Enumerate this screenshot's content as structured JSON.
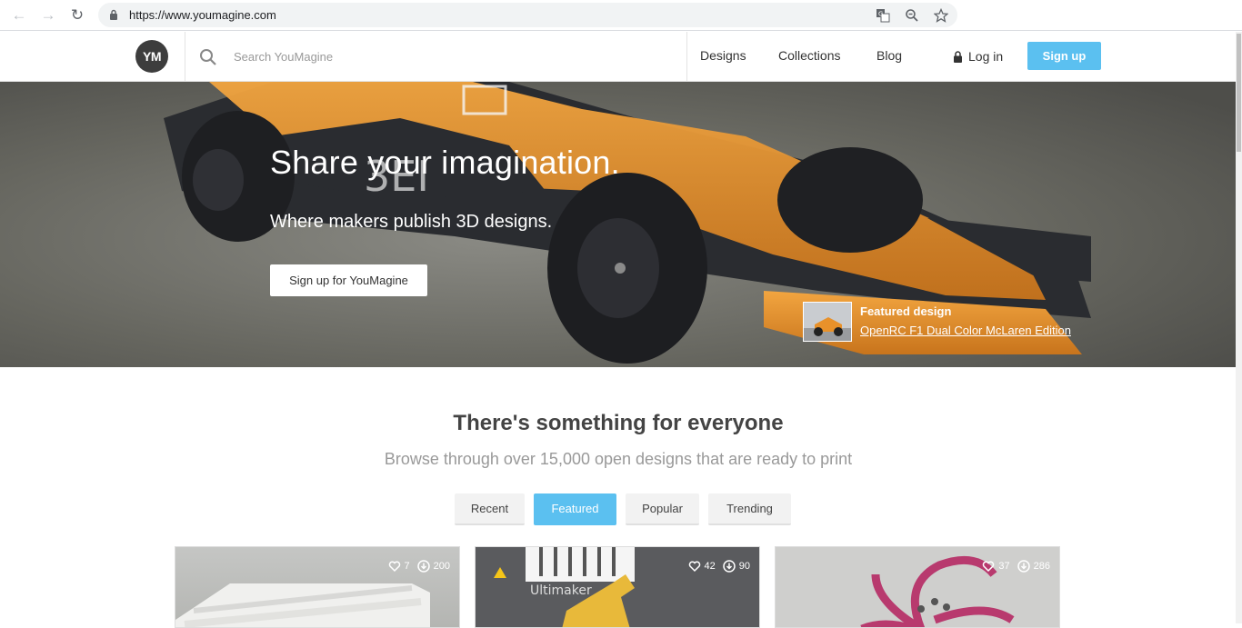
{
  "browser": {
    "url": "https://www.youmagine.com"
  },
  "header": {
    "logo_text": "YM",
    "search_placeholder": "Search YouMagine",
    "nav": [
      "Designs",
      "Collections",
      "Blog"
    ],
    "login_label": "Log in",
    "signup_label": "Sign up"
  },
  "hero": {
    "title": "Share your imagination.",
    "subtitle": "Where makers publish 3D designs.",
    "cta_label": "Sign up for YouMagine",
    "featured_label": "Featured design",
    "featured_link": "OpenRC F1 Dual Color McLaren Edition"
  },
  "main": {
    "title": "There's something for everyone",
    "subtitle": "Browse through over 15,000 open designs that are ready to print",
    "tabs": [
      "Recent",
      "Featured",
      "Popular",
      "Trending"
    ],
    "active_tab": "Featured",
    "cards": [
      {
        "likes": "7",
        "downloads": "200"
      },
      {
        "likes": "42",
        "downloads": "90"
      },
      {
        "likes": "37",
        "downloads": "286"
      }
    ]
  },
  "colors": {
    "accent": "#5bc0f0",
    "car_orange": "#e8912a"
  }
}
